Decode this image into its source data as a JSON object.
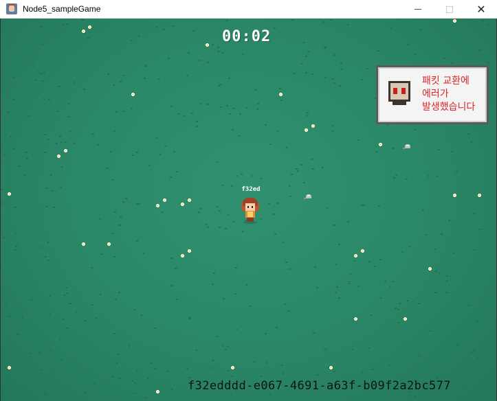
{
  "window": {
    "title": "Node5_sampleGame",
    "close_glyph": "✕"
  },
  "hud": {
    "timer": "00:02"
  },
  "error_panel": {
    "message": "패킷 교환에\n에러가\n발생했습니다",
    "text_color": "#e02424",
    "icon": "skull-icon"
  },
  "player": {
    "name_tag": "f32ed"
  },
  "footer": {
    "session_id": "f32edddd-e067-4691-a63f-b09f2a2bc577"
  },
  "colors": {
    "grass_background": "#2a8666",
    "flower": "#f5ecd0"
  }
}
